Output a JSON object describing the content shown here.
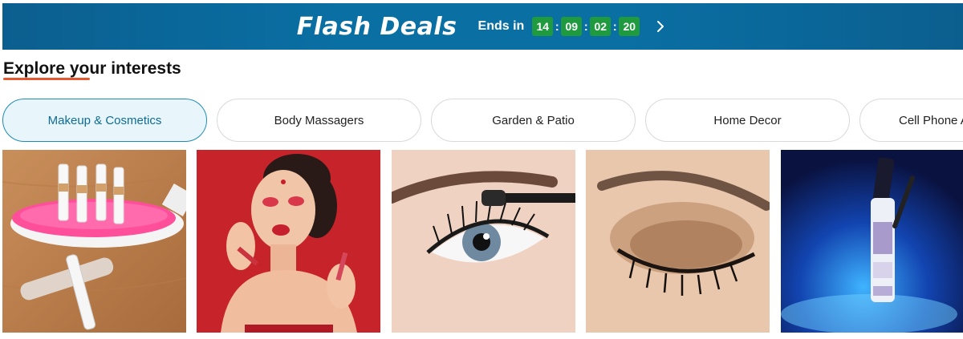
{
  "banner": {
    "title": "Flash Deals",
    "ends_label": "Ends in",
    "timer": [
      "14",
      "09",
      "02",
      "20"
    ],
    "separator": ":",
    "arrow_icon": "chevron-right-icon",
    "colors": {
      "background": "#0a6fa3",
      "timer_box": "#1f9a3e"
    }
  },
  "section": {
    "title": "Explore your interests",
    "underline_color": "#e5582f"
  },
  "tabs": [
    {
      "label": "Makeup & Cosmetics",
      "active": true
    },
    {
      "label": "Body Massagers",
      "active": false
    },
    {
      "label": "Garden & Patio",
      "active": false
    },
    {
      "label": "Home Decor",
      "active": false
    },
    {
      "label": "Cell Phone Accessories",
      "active": false
    }
  ],
  "products": [
    {
      "image": "makeup-brush-holder-photo"
    },
    {
      "image": "model-lip-gloss-photo"
    },
    {
      "image": "mascara-eye-closeup-photo"
    },
    {
      "image": "eyeshadow-closed-eye-photo"
    },
    {
      "image": "mascara-tube-blue-photo"
    }
  ]
}
